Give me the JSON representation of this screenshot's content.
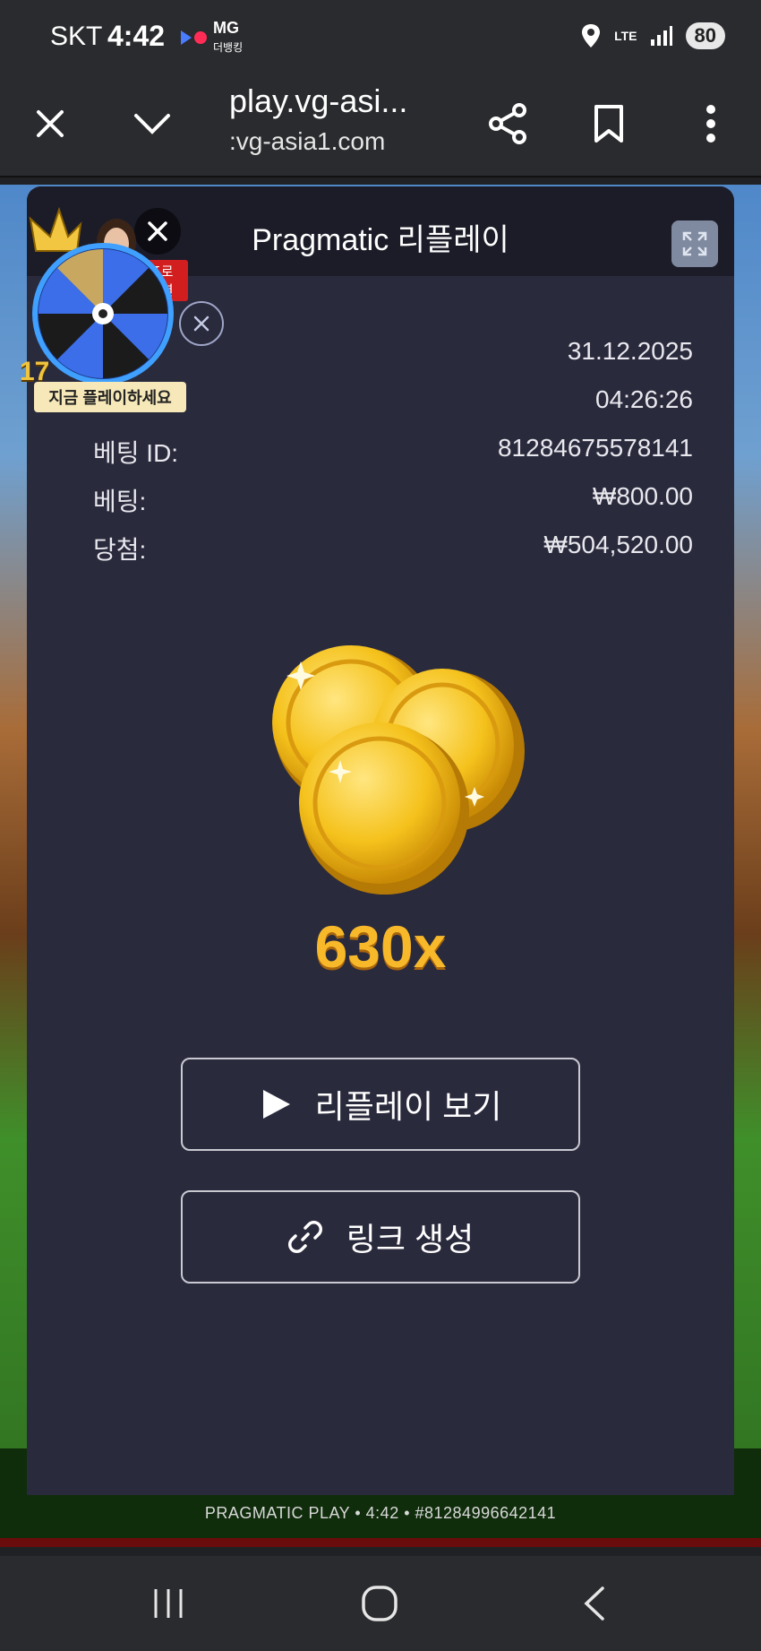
{
  "status_bar": {
    "carrier": "SKT",
    "time": "4:42",
    "app_badge": "MG",
    "app_badge_sub": "더뱅킹",
    "network": "LTE",
    "battery": "80"
  },
  "browser": {
    "page_title": "play.vg-asi...",
    "url": ":vg-asia1.com"
  },
  "modal": {
    "title": "Pragmatic 리플레이",
    "info_rows": [
      {
        "label": "",
        "value": "31.12.2025"
      },
      {
        "label": "",
        "value": "04:26:26"
      },
      {
        "label": "베팅 ID:",
        "value": "81284675578141"
      },
      {
        "label": "베팅:",
        "value": "₩800.00"
      },
      {
        "label": "당첨:",
        "value": "₩504,520.00"
      }
    ],
    "multiplier": "630x",
    "replay_button": "리플레이 보기",
    "link_button": "링크 생성"
  },
  "promo": {
    "badge": "프로모션",
    "amount": "17",
    "caption": "지금 플레이하세요"
  },
  "game": {
    "footer": "PRAGMATIC PLAY • 4:42 • #81284996642141"
  },
  "colors": {
    "modal_bg": "#2a2a3d",
    "multiplier": "#f7b92a",
    "browser_bar": "#2a2b2e"
  }
}
